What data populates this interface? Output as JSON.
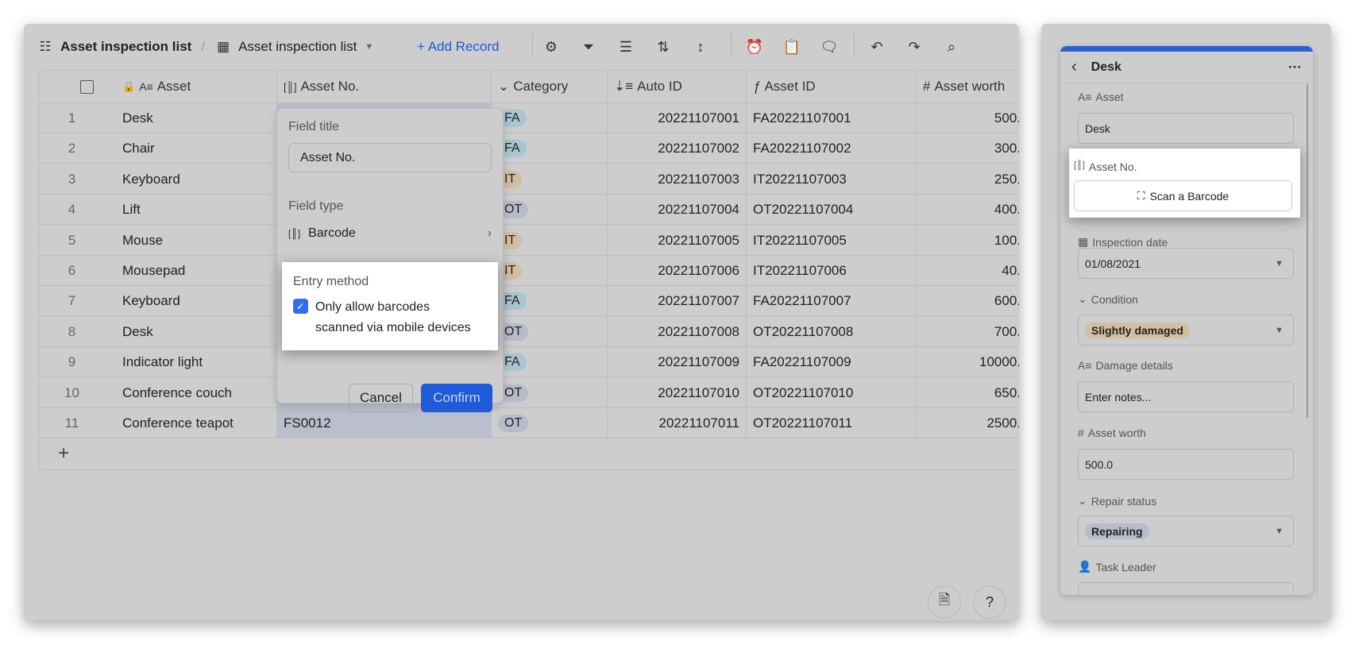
{
  "toolbar": {
    "breadcrumb_base": "Asset inspection list",
    "view_name": "Asset inspection list",
    "add_record": "+ Add Record"
  },
  "columns": [
    "Asset",
    "Asset No.",
    "Category",
    "Auto ID",
    "Asset ID",
    "Asset worth"
  ],
  "rows": [
    {
      "n": "1",
      "asset": "Desk",
      "no": "",
      "cat": "FA",
      "auto": "20221107001",
      "aid": "FA20221107001",
      "worth": "500."
    },
    {
      "n": "2",
      "asset": "Chair",
      "no": "",
      "cat": "FA",
      "auto": "20221107002",
      "aid": "FA20221107002",
      "worth": "300."
    },
    {
      "n": "3",
      "asset": "Keyboard",
      "no": "",
      "cat": "IT",
      "auto": "20221107003",
      "aid": "IT20221107003",
      "worth": "250."
    },
    {
      "n": "4",
      "asset": "Lift",
      "no": "",
      "cat": "OT",
      "auto": "20221107004",
      "aid": "OT20221107004",
      "worth": "400."
    },
    {
      "n": "5",
      "asset": "Mouse",
      "no": "",
      "cat": "IT",
      "auto": "20221107005",
      "aid": "IT20221107005",
      "worth": "100."
    },
    {
      "n": "6",
      "asset": "Mousepad",
      "no": "",
      "cat": "IT",
      "auto": "20221107006",
      "aid": "IT20221107006",
      "worth": "40."
    },
    {
      "n": "7",
      "asset": "Keyboard",
      "no": "",
      "cat": "FA",
      "auto": "20221107007",
      "aid": "FA20221107007",
      "worth": "600."
    },
    {
      "n": "8",
      "asset": "Desk",
      "no": "",
      "cat": "OT",
      "auto": "20221107008",
      "aid": "OT20221107008",
      "worth": "700."
    },
    {
      "n": "9",
      "asset": "Indicator light",
      "no": "",
      "cat": "FA",
      "auto": "20221107009",
      "aid": "FA20221107009",
      "worth": "10000."
    },
    {
      "n": "10",
      "asset": "Conference couch",
      "no": "",
      "cat": "OT",
      "auto": "20221107010",
      "aid": "OT20221107010",
      "worth": "650."
    },
    {
      "n": "11",
      "asset": "Conference teapot",
      "no": "FS0012",
      "cat": "OT",
      "auto": "20221107011",
      "aid": "OT20221107011",
      "worth": "2500."
    }
  ],
  "category_colors": {
    "FA": "#a9c5cf",
    "IT": "#d3bea4",
    "OT": "#b7bccb"
  },
  "popup": {
    "field_title_label": "Field title",
    "field_title_value": "Asset No.",
    "field_type_label": "Field type",
    "field_type_value": "Barcode",
    "entry_method_label": "Entry method",
    "checkbox_line1": "Only allow barcodes",
    "checkbox_line2": "scanned via mobile devices",
    "checked": true,
    "cancel": "Cancel",
    "confirm": "Confirm"
  },
  "record": {
    "title": "Desk",
    "asset_label": "Asset",
    "asset_value": "Desk",
    "asset_no_label": "Asset No.",
    "scan_button": "Scan a Barcode",
    "date_label": "Inspection date",
    "date_value": "01/08/2021",
    "condition_label": "Condition",
    "condition_value": "Slightly damaged",
    "damage_label": "Damage details",
    "damage_placeholder": "Enter notes...",
    "worth_label": "Asset worth",
    "worth_value": "500.0",
    "repair_label": "Repair status",
    "repair_value": "Repairing",
    "leader_label": "Task Leader"
  },
  "accent": "#1f5ad8"
}
